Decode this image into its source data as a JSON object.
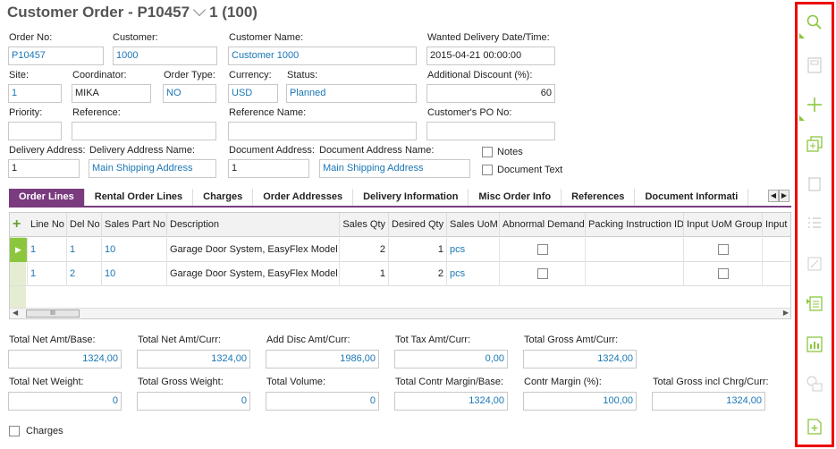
{
  "header": {
    "title": "Customer Order - P10457",
    "suffix": "1 (100)"
  },
  "labels": {
    "order_no": "Order No:",
    "customer": "Customer:",
    "customer_name": "Customer Name:",
    "wanted_delivery": "Wanted Delivery Date/Time:",
    "site": "Site:",
    "coordinator": "Coordinator:",
    "order_type": "Order Type:",
    "currency": "Currency:",
    "status": "Status:",
    "additional_discount": "Additional Discount (%):",
    "priority": "Priority:",
    "reference": "Reference:",
    "reference_name": "Reference Name:",
    "customers_po": "Customer's PO No:",
    "delivery_address": "Delivery Address:",
    "delivery_address_name": "Delivery Address Name:",
    "document_address": "Document Address:",
    "document_address_name": "Document Address Name:",
    "notes": "Notes",
    "document_text": "Document Text"
  },
  "values": {
    "order_no": "P10457",
    "customer": "1000",
    "customer_name": "Customer 1000",
    "wanted_delivery": "2015-04-21 00:00:00",
    "site": "1",
    "coordinator": "MIKA",
    "order_type": "NO",
    "currency": "USD",
    "status": "Planned",
    "additional_discount": "60",
    "priority": "",
    "reference": "",
    "reference_name": "",
    "customers_po": "",
    "delivery_address": "1",
    "delivery_address_name": "Main Shipping Address",
    "document_address": "1",
    "document_address_name": "Main Shipping Address"
  },
  "tabs": [
    "Order Lines",
    "Rental Order Lines",
    "Charges",
    "Order Addresses",
    "Delivery Information",
    "Misc Order Info",
    "References",
    "Document Informati"
  ],
  "grid": {
    "columns": [
      "Line No",
      "Del No",
      "Sales Part No",
      "Description",
      "Sales Qty",
      "Desired Qty",
      "Sales UoM",
      "Abnormal Demand",
      "Packing Instruction ID",
      "Input UoM Group",
      "Input U"
    ],
    "rows": [
      {
        "line_no": "1",
        "del_no": "1",
        "sales_part_no": "10",
        "description": "Garage Door System, EasyFlex Model",
        "sales_qty": "2",
        "desired_qty": "1",
        "sales_uom": "pcs"
      },
      {
        "line_no": "1",
        "del_no": "2",
        "sales_part_no": "10",
        "description": "Garage Door System, EasyFlex Model",
        "sales_qty": "1",
        "desired_qty": "2",
        "sales_uom": "pcs"
      }
    ],
    "scroll_thumb": "III"
  },
  "totals": {
    "labels": {
      "net_amt_base": "Total Net Amt/Base:",
      "net_amt_curr": "Total Net Amt/Curr:",
      "add_disc": "Add Disc Amt/Curr:",
      "tot_tax": "Tot Tax Amt/Curr:",
      "gross_amt": "Total Gross Amt/Curr:",
      "net_weight": "Total Net Weight:",
      "gross_weight": "Total Gross Weight:",
      "volume": "Total Volume:",
      "contr_margin_base": "Total Contr Margin/Base:",
      "contr_margin_pct": "Contr Margin (%):",
      "gross_incl_chrg": "Total Gross incl Chrg/Curr:"
    },
    "values": {
      "net_amt_base": "1324,00",
      "net_amt_curr": "1324,00",
      "add_disc": "1986,00",
      "tot_tax": "0,00",
      "gross_amt": "1324,00",
      "net_weight": "0",
      "gross_weight": "0",
      "volume": "0",
      "contr_margin_base": "1324,00",
      "contr_margin_pct": "100,00",
      "gross_incl_chrg": "1324,00"
    }
  },
  "charges_label": "Charges",
  "colors": {
    "accent": "#7a3b7f",
    "link": "#1a77b5",
    "icon_green": "#8cc63f",
    "toolbar_border": "#e00000"
  }
}
